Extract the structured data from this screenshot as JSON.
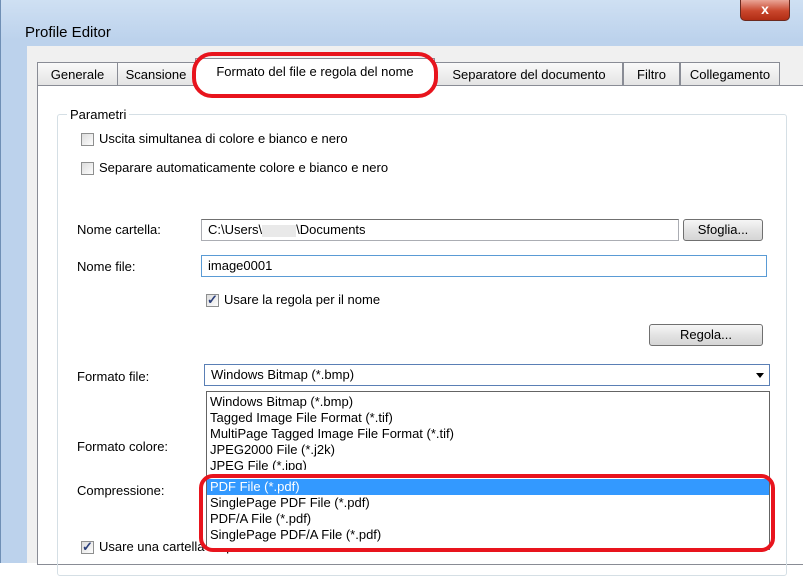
{
  "window": {
    "title": "Profile Editor",
    "close_glyph": "x"
  },
  "tabs": [
    {
      "label": "Generale"
    },
    {
      "label": "Scansione"
    },
    {
      "label": "Formato del file e regola del nome"
    },
    {
      "label": "Separatore del documento"
    },
    {
      "label": "Filtro"
    },
    {
      "label": "Collegamento"
    }
  ],
  "active_tab": "Formato del file e regola del nome",
  "group": {
    "title": "Parametri"
  },
  "checkboxes": {
    "simultaneous": {
      "label": "Uscita simultanea di colore e bianco e nero",
      "checked": false
    },
    "auto_separate": {
      "label": "Separare automaticamente colore e bianco e nero",
      "checked": false
    },
    "use_rule": {
      "label": "Usare la regola per il nome",
      "checked": true
    },
    "sequential_folder": {
      "label": "Usare una cartella sequenziale",
      "checked": true
    }
  },
  "folder": {
    "label": "Nome cartella:",
    "value_prefix": "C:\\Users\\",
    "value_suffix": "\\Documents",
    "browse_label": "Sfoglia..."
  },
  "filename": {
    "label": "Nome file:",
    "value": "image0001"
  },
  "rule_button": {
    "label": "Regola..."
  },
  "file_format": {
    "label": "Formato file:",
    "selected": "Windows Bitmap (*.bmp)",
    "options": [
      "Windows Bitmap (*.bmp)",
      "Tagged Image File Format (*.tif)",
      "MultiPage Tagged Image File Format (*.tif)",
      "JPEG2000 File (*.j2k)",
      "JPEG File (*.jpg)",
      "PDF File (*.pdf)",
      "SinglePage PDF File (*.pdf)",
      "PDF/A File (*.pdf)",
      "SinglePage PDF/A File (*.pdf)"
    ],
    "highlighted_option": "PDF File (*.pdf)"
  },
  "color_format": {
    "label": "Formato colore:"
  },
  "compression": {
    "label": "Compressione:"
  },
  "colors": {
    "annotation_red": "#e8141d",
    "selection_blue": "#3399ff"
  }
}
